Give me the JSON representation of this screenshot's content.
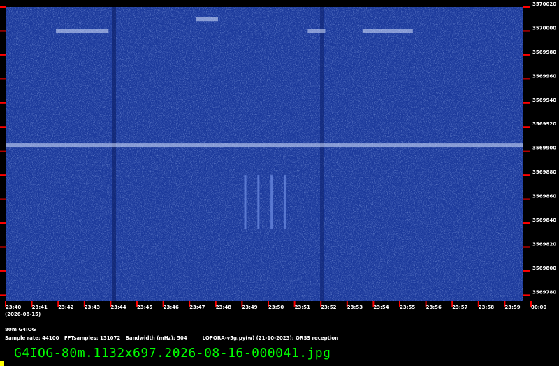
{
  "chart_data": {
    "type": "heatmap",
    "title": "",
    "xlabel": "",
    "ylabel": "",
    "date_label": "(2026-08-15)",
    "x_ticks": [
      "23:40",
      "23:41",
      "23:42",
      "23:43",
      "23:44",
      "23:45",
      "23:46",
      "23:47",
      "23:48",
      "23:49",
      "23:50",
      "23:51",
      "23:52",
      "23:53",
      "23:54",
      "23:55",
      "23:56",
      "23:57",
      "23:58",
      "23:59",
      "00:00"
    ],
    "y_ticks": [
      3570020,
      3570000,
      3569980,
      3569960,
      3569940,
      3569920,
      3569900,
      3569880,
      3569860,
      3569840,
      3569820,
      3569800,
      3569780
    ],
    "ylim": [
      3569775,
      3570020
    ],
    "grid": false,
    "signals": [
      {
        "start": "23:41:55",
        "end": "23:43:55",
        "freq": 3570000
      },
      {
        "start": "23:51:30",
        "end": "23:52:10",
        "freq": 3570000
      },
      {
        "start": "23:53:35",
        "end": "23:55:30",
        "freq": 3570000
      },
      {
        "start": "23:47:15",
        "end": "23:48:05",
        "freq": 3570010
      },
      {
        "start": "23:40:00",
        "end": "23:59:59",
        "freq": 3569905
      }
    ],
    "colors": {
      "background": "#1c3a9c",
      "noise_light": "#6f8fe6",
      "signal": "#dbe6ff",
      "tick": "#ff0000",
      "text": "#ffffff"
    }
  },
  "footer": {
    "station": "80m G4IOG",
    "sample_rate": "Sample rate: 44100",
    "fft_samples": "FFTsamples: 131072",
    "bandwidth": "Bandwidth (mHz): 504",
    "software": "LOPORA-v5g.py(w) (21-10-2023): QRSS reception"
  },
  "filename": "G4IOG-80m.1132x697.2026-08-16-000041.jpg"
}
